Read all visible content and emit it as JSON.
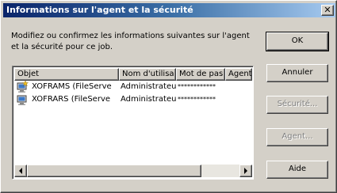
{
  "window": {
    "title": "Informations sur l'agent et la sécurité",
    "close_glyph": "✕"
  },
  "description": "Modifiez ou confirmez les informations suivantes sur l'agent et la sécurité pour ce job.",
  "list": {
    "columns": [
      "Objet",
      "Nom d'utilisa",
      "Mot de pas",
      "Agent"
    ],
    "rows": [
      {
        "icon": "computer-star-icon",
        "object": "XOFRAMS (FileServe",
        "user": "Administrateu",
        "password": "************",
        "agent": ""
      },
      {
        "icon": "computer-icon",
        "object": "XOFRARS (FileServe",
        "user": "Administrateu",
        "password": "************",
        "agent": ""
      }
    ]
  },
  "buttons": {
    "ok": "OK",
    "cancel": "Annuler",
    "security": "Sécurité...",
    "agent": "Agent...",
    "help": "Aide"
  }
}
